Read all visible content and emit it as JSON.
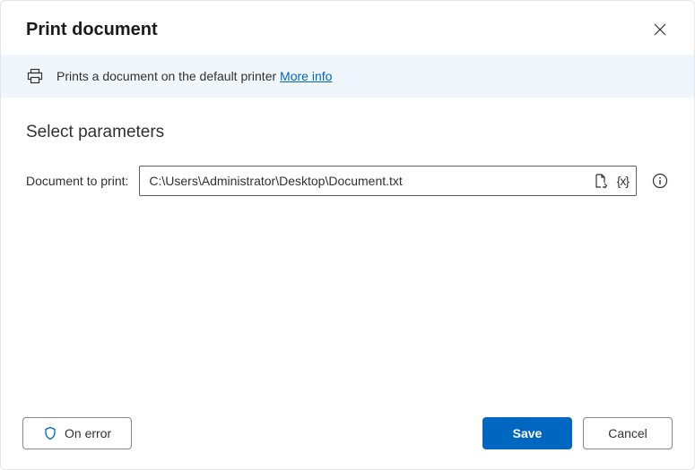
{
  "header": {
    "title": "Print document"
  },
  "banner": {
    "text": "Prints a document on the default printer ",
    "link_label": "More info",
    "printer_icon": "printer-icon"
  },
  "section": {
    "title": "Select parameters"
  },
  "params": {
    "document_label": "Document to print:",
    "document_value": "C:\\Users\\Administrator\\Desktop\\Document.txt"
  },
  "footer": {
    "on_error_label": "On error",
    "save_label": "Save",
    "cancel_label": "Cancel"
  }
}
